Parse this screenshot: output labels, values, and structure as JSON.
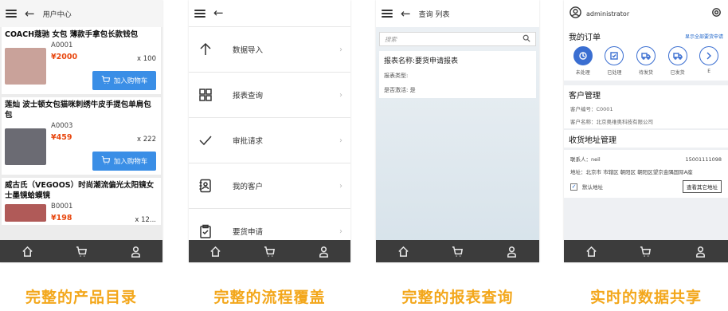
{
  "colors": {
    "caption": "#f3a71b",
    "price": "#e8470f",
    "button": "#3a8ee6",
    "accent_blue": "#3a6ed1",
    "bottom_bar": "#3c3c3c"
  },
  "panel1": {
    "title": "用户中心",
    "cart_label": "加入购物车",
    "products": [
      {
        "name": "COACH蔻驰 女包 薄款手拿包长款钱包",
        "code": "A0001",
        "price": "¥2000",
        "qty": "x 100",
        "thumb_color": "#c9a29a",
        "has_cart": true
      },
      {
        "name": "莲灿 波士顿女包猫咪刺绣牛皮手提包单肩包包",
        "code": "A0003",
        "price": "¥459",
        "qty": "x 222",
        "thumb_color": "#6b6b73",
        "has_cart": true
      },
      {
        "name": "威古氏（VEGOOS）时尚潮流偏光太阳镜女士墨镜蛤蟆镜",
        "code": "B0001",
        "price": "¥198",
        "qty": "x 12...",
        "thumb_color": "#b05a58",
        "has_cart": false
      }
    ]
  },
  "panel2": {
    "items": [
      {
        "label": "数据导入",
        "icon": "arrow-up-icon"
      },
      {
        "label": "报表查询",
        "icon": "report-icon"
      },
      {
        "label": "审批请求",
        "icon": "check-icon"
      },
      {
        "label": "我的客户",
        "icon": "contacts-icon"
      },
      {
        "label": "要货申请",
        "icon": "clipboard-icon"
      }
    ]
  },
  "panel3": {
    "title": "查询 列表",
    "search_placeholder": "搜索",
    "report_title": "报表名称:要货申请报表",
    "report_type": "报表类型:",
    "report_active": "是否激活: 是"
  },
  "panel4": {
    "username": "administrator",
    "orders_title": "我的订单",
    "orders_link": "显示全部要货申请",
    "order_states": [
      "未处理",
      "已处理",
      "待发货",
      "已发货",
      "E"
    ],
    "customer_title": "客户管理",
    "customer_code": "客户编号：C0001",
    "customer_name": "客户名称：北京奥维奥科技有限公司",
    "address_title": "收货地址管理",
    "contact": "联系人：neil",
    "phone": "15001111098",
    "address": "地址：北京市 市辖区 朝阳区 朝阳区望京金隅国际A座",
    "default_label": "默认地址",
    "view_other": "查看其它地址"
  },
  "captions": [
    "完整的产品目录",
    "完整的流程覆盖",
    "完整的报表查询",
    "实时的数据共享"
  ]
}
